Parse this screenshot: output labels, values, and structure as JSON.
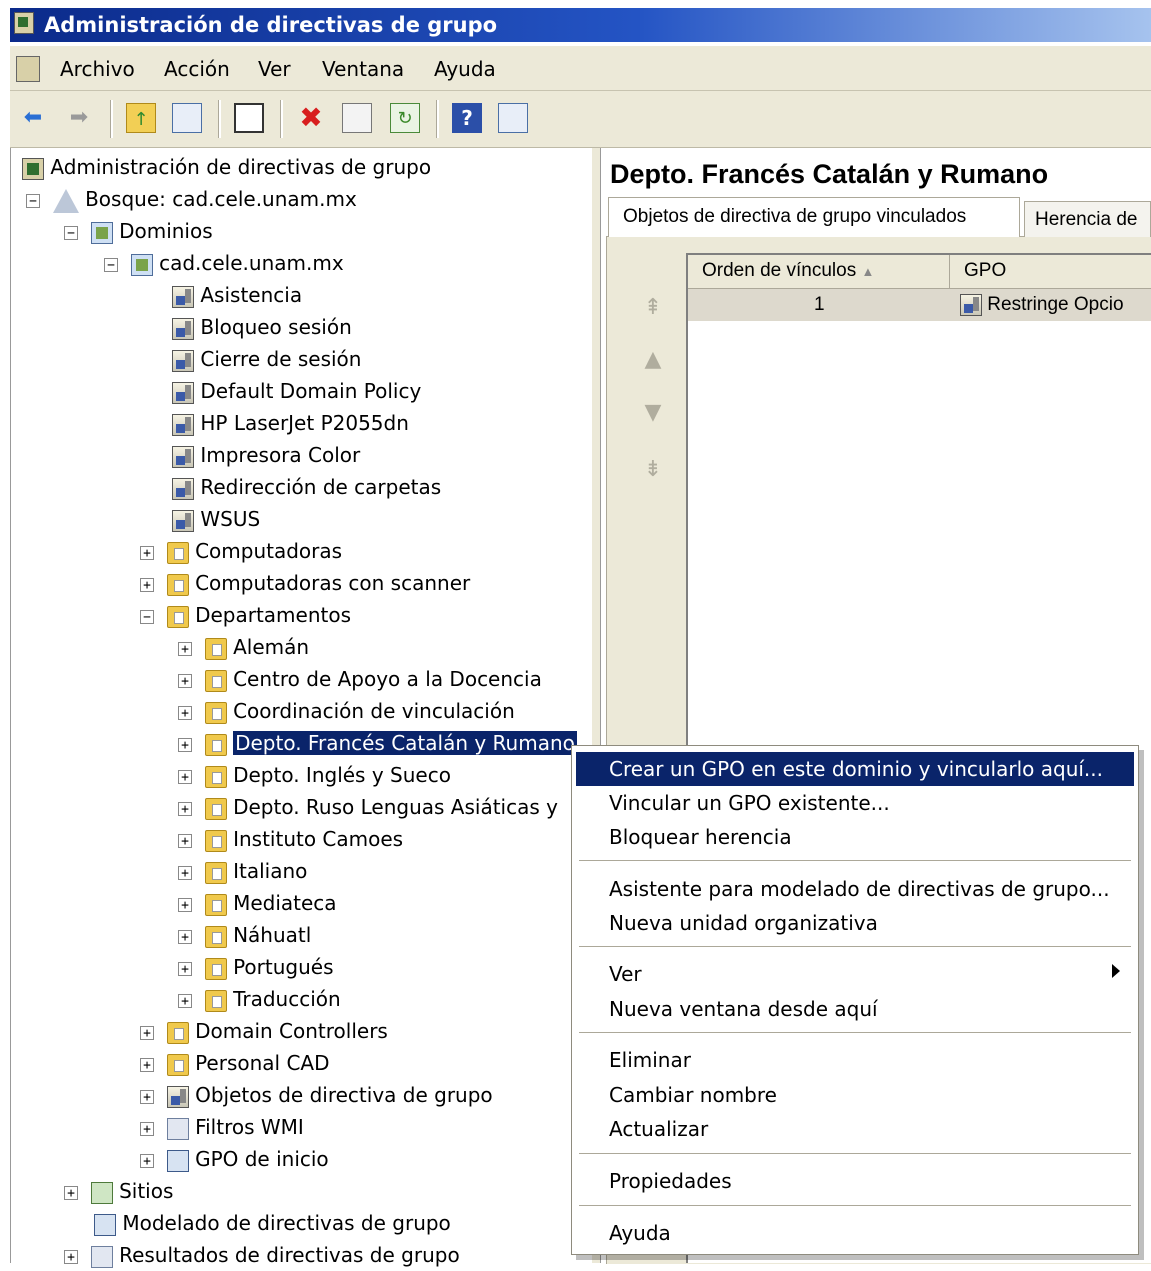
{
  "window": {
    "title": "Administración de directivas de grupo"
  },
  "menubar": {
    "items": [
      "Archivo",
      "Acción",
      "Ver",
      "Ventana",
      "Ayuda"
    ]
  },
  "toolbar": {
    "buttons": [
      "back-icon",
      "forward-icon",
      "up-folder-icon",
      "show-hide-tree-icon",
      "copy-icon",
      "delete-icon",
      "properties-icon",
      "refresh-icon",
      "help-icon",
      "action-pane-icon"
    ]
  },
  "tree": {
    "root": "Administración de directivas de grupo",
    "forest": "Bosque: cad.cele.unam.mx",
    "domains": "Dominios",
    "domain": "cad.cele.unam.mx",
    "gpo_links": [
      "Asistencia",
      "Bloqueo sesión",
      "Cierre de sesión",
      "Default Domain Policy",
      "HP LaserJet P2055dn",
      "Impresora Color",
      "Redirección de carpetas",
      "WSUS"
    ],
    "ous_top": [
      "Computadoras",
      "Computadoras con scanner"
    ],
    "departamentos": "Departamentos",
    "dept_children": [
      "Alemán",
      "Centro de Apoyo a la Docencia",
      "Coordinación de vinculación",
      "Depto. Francés Catalán y Rumano",
      "Depto. Inglés y Sueco",
      "Depto. Ruso Lenguas Asiáticas y",
      "Instituto Camoes",
      "Italiano",
      "Mediateca",
      "Náhuatl",
      "Portugués",
      "Traducción"
    ],
    "ous_bottom": [
      "Domain Controllers",
      "Personal CAD"
    ],
    "containers": [
      "Objetos de directiva de grupo",
      "Filtros WMI",
      "GPO de inicio"
    ],
    "sites": "Sitios",
    "modeling": "Modelado de directivas de grupo",
    "results": "Resultados de directivas de grupo",
    "selected": "Depto. Francés Catalán y Rumano"
  },
  "details": {
    "title": "Depto. Francés Catalán y Rumano",
    "tabs": [
      "Objetos de directiva de grupo vinculados",
      "Herencia de"
    ],
    "columns": [
      "Orden de vínculos",
      "GPO"
    ],
    "rows": [
      {
        "order": "1",
        "gpo": "Restringe Opcio"
      }
    ]
  },
  "context_menu": {
    "items": [
      "Crear un GPO en este dominio y vincularlo aquí...",
      "Vincular un GPO existente...",
      "Bloquear herencia",
      "Asistente para modelado de directivas de grupo...",
      "Nueva unidad organizativa",
      "Ver",
      "Nueva ventana desde aquí",
      "Eliminar",
      "Cambiar nombre",
      "Actualizar",
      "Propiedades",
      "Ayuda"
    ],
    "highlighted": "Crear un GPO en este dominio y vincularlo aquí..."
  },
  "colors": {
    "titlebar": "#0b2a8a",
    "selection": "#0a246a",
    "chrome": "#ece9d8"
  }
}
